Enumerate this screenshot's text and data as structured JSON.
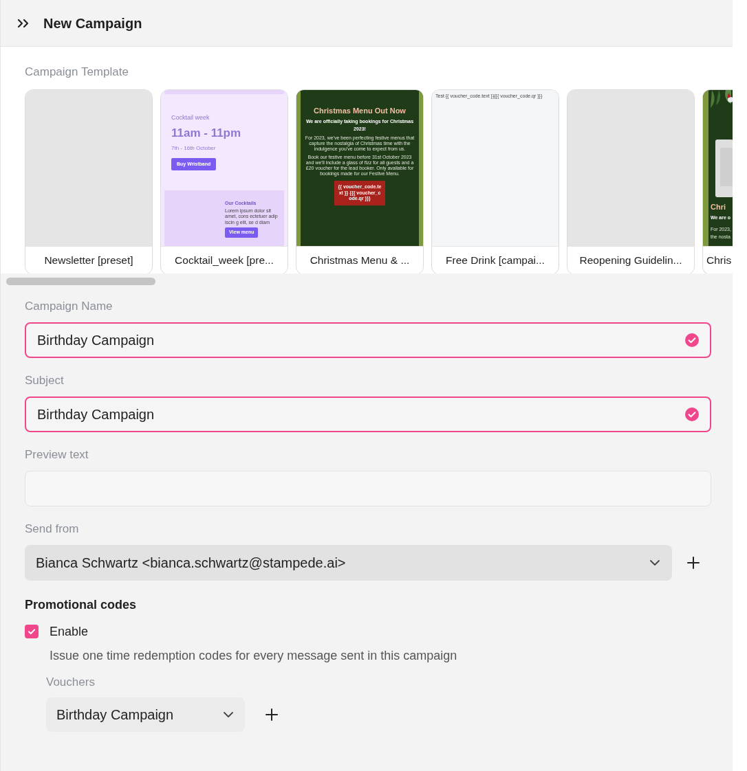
{
  "header": {
    "title": "New Campaign"
  },
  "templates": {
    "label": "Campaign Template",
    "cards": [
      {
        "kind": "blank",
        "name": "Newsletter [preset]"
      },
      {
        "kind": "cocktail",
        "name": "Cocktail_week [pre...",
        "eyebrow": "Cocktail week",
        "time": "11am - 11pm",
        "dates": "7th - 16th October",
        "button": "Buy Wristband",
        "section_title": "Our Cocktails",
        "section_text": "Lorem ipsum dolor sit amet, cons ectetuer adip iscin g elit, se d diam",
        "section_button": "View menu"
      },
      {
        "kind": "christmas",
        "name": "Christmas Menu & ...",
        "heading": "Christmas Menu Out Now",
        "subheading": "We are officially taking bookings for Christmas 2023!",
        "paragraphs": [
          "For 2023, we've been perfecting festive menus that capture the nostalgia of Christmas time with the indulgence you've come to expect from us.",
          "Book our festive menu before 31st October 2023 and we'll include a glass of fizz for all guests and a £20 voucher for the lead booker. Only available for bookings made for our Festive Menu."
        ],
        "voucher": "{{ voucher_code.text }} {{{ voucher_code.qr }}}"
      },
      {
        "kind": "text",
        "name": "Free Drink [campai...",
        "text": "Test {{ voucher_code.text }}{{{ voucher_code.qr }}}"
      },
      {
        "kind": "blank",
        "name": "Reopening Guidelin..."
      },
      {
        "kind": "partial",
        "name": "Chris",
        "heading": "Chri",
        "subheading": "We are o",
        "paragraphs": [
          "For 2023,",
          "the nosta"
        ]
      }
    ]
  },
  "fields": [
    {
      "kind": "text",
      "label": "Campaign Name",
      "value": "Birthday Campaign",
      "valid": true
    },
    {
      "kind": "text",
      "label": "Subject",
      "value": "Birthday Campaign",
      "valid": true
    },
    {
      "kind": "text",
      "label": "Preview text",
      "valid": false
    },
    {
      "kind": "select",
      "label": "Send from",
      "value": "Bianca Schwartz <bianca.schwartz@stampede.ai>",
      "valid": false
    }
  ],
  "promo": {
    "title": "Promotional codes",
    "enable_label": "Enable",
    "checked": true,
    "description": "Issue one time redemption codes for every message sent in this campaign",
    "vouchers_label": "Vouchers",
    "voucher": "Birthday Campaign"
  }
}
